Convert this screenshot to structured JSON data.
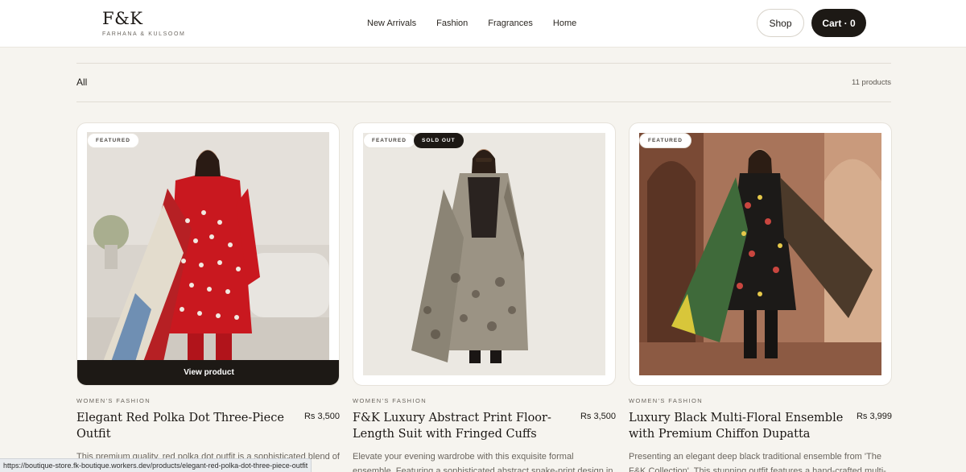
{
  "header": {
    "logo": "F&K",
    "tagline": "FARHANA & KULSOOM",
    "nav": [
      "New Arrivals",
      "Fashion",
      "Fragrances",
      "Home"
    ],
    "shop_label": "Shop",
    "cart_label": "Cart · 0"
  },
  "toolbar": {
    "filter": "All",
    "count": "11 products"
  },
  "products": [
    {
      "badges": [
        "FEATURED"
      ],
      "button": "View product",
      "category": "WOMEN'S FASHION",
      "title": "Elegant Red Polka Dot Three-Piece Outfit",
      "price": "Rs 3,500",
      "description": "This premium quality, red polka dot outfit is a sophisticated blend of modern patterns and traditional South Asian style. The"
    },
    {
      "badges": [
        "FEATURED",
        "SOLD OUT"
      ],
      "category": "WOMEN'S FASHION",
      "title": "F&K Luxury Abstract Print Floor-Length Suit with Fringed Cuffs",
      "price": "Rs 3,500",
      "description": "Elevate your evening wardrobe with this exquisite formal ensemble. Featuring a sophisticated abstract snake-print design in"
    },
    {
      "badges": [
        "FEATURED"
      ],
      "category": "WOMEN'S FASHION",
      "title": "Luxury Black Multi-Floral Ensemble with Premium Chiffon Dupatta",
      "price": "Rs 3,999",
      "description": "Presenting an elegant deep black traditional ensemble from 'The F&K Collection'. This stunning outfit features a hand-crafted multi-"
    }
  ],
  "status_bar": "https://boutique-store.fk-boutique.workers.dev/products/elegant-red-polka-dot-three-piece-outfit",
  "colors": {
    "background": "#f6f4ef",
    "dark": "#1d1915",
    "muted_text": "#6a655e"
  }
}
